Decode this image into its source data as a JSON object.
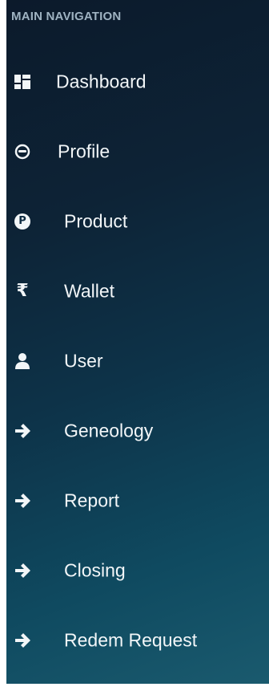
{
  "header": {
    "title": "MAIN NAVIGATION"
  },
  "menu": {
    "items": [
      {
        "label": "Dashboard",
        "icon": "dashboard-icon"
      },
      {
        "label": "Profile",
        "icon": "profile-icon"
      },
      {
        "label": "Product",
        "icon": "product-icon"
      },
      {
        "label": "Wallet",
        "icon": "rupee-icon"
      },
      {
        "label": "User",
        "icon": "user-icon"
      },
      {
        "label": "Geneology",
        "icon": "arrow-right-icon"
      },
      {
        "label": "Report",
        "icon": "arrow-right-icon"
      },
      {
        "label": "Closing",
        "icon": "arrow-right-icon"
      },
      {
        "label": "Redem Request",
        "icon": "arrow-right-icon"
      }
    ]
  },
  "colors": {
    "text": "#f2f6f8",
    "header_text": "#9fb3c2",
    "background_top": "#0c1a2b",
    "background_bottom": "#1a5a6e"
  },
  "icons": {
    "rupee_glyph": "₹",
    "product_glyph": "P"
  }
}
